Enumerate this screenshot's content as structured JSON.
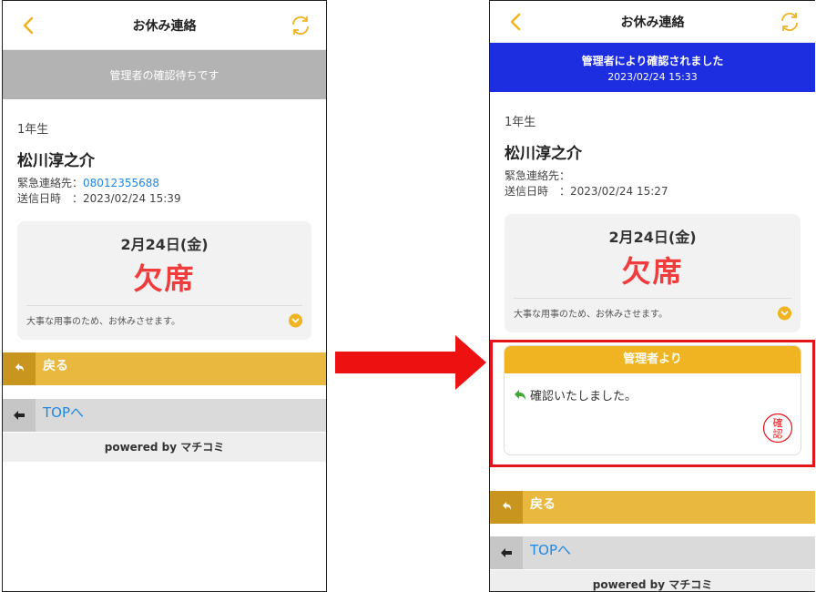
{
  "left": {
    "nav_title": "お休み連絡",
    "status_text": "管理者の確認待ちです",
    "grade": "1年生",
    "student_name": "松川淳之介",
    "emergency_label": "緊急連絡先：",
    "emergency_phone": "08012355688",
    "sent_label": "送信日時　：",
    "sent_at": "2023/02/24 15:39",
    "card_date": "2月24日(金)",
    "card_kind": "欠席",
    "card_reason": "大事な用事のため、お休みさせます。",
    "back_label": "戻る",
    "top_label": "TOPへ",
    "footer": "powered by マチコミ"
  },
  "right": {
    "nav_title": "お休み連絡",
    "status_text": "管理者により確認されました",
    "status_time": "2023/02/24 15:33",
    "grade": "1年生",
    "student_name": "松川淳之介",
    "emergency_label": "緊急連絡先：",
    "sent_label": "送信日時　：",
    "sent_at": "2023/02/24 15:27",
    "card_date": "2月24日(金)",
    "card_kind": "欠席",
    "card_reason": "大事な用事のため、お休みさせます。",
    "reply_header": "管理者より",
    "reply_text": "確認いたしました。",
    "seal_chars": [
      "確",
      "認"
    ],
    "back_label": "戻る",
    "top_label": "TOPへ",
    "footer": "powered by マチコミ"
  },
  "colors": {
    "accent": "#f0b422",
    "confirmed_banner": "#1d2de0",
    "pending_banner": "#b3b3b3",
    "absence_red": "#f03c3c",
    "highlight_border": "#e5141a",
    "link_blue": "#1e88e5"
  },
  "icons": {
    "back": "chevron-left-icon",
    "refresh": "refresh-icon",
    "reply": "reply-arrow-icon",
    "expand": "chevron-down-icon",
    "return": "return-icon",
    "top": "arrow-left-icon",
    "seal": "confirmed-seal-icon"
  }
}
